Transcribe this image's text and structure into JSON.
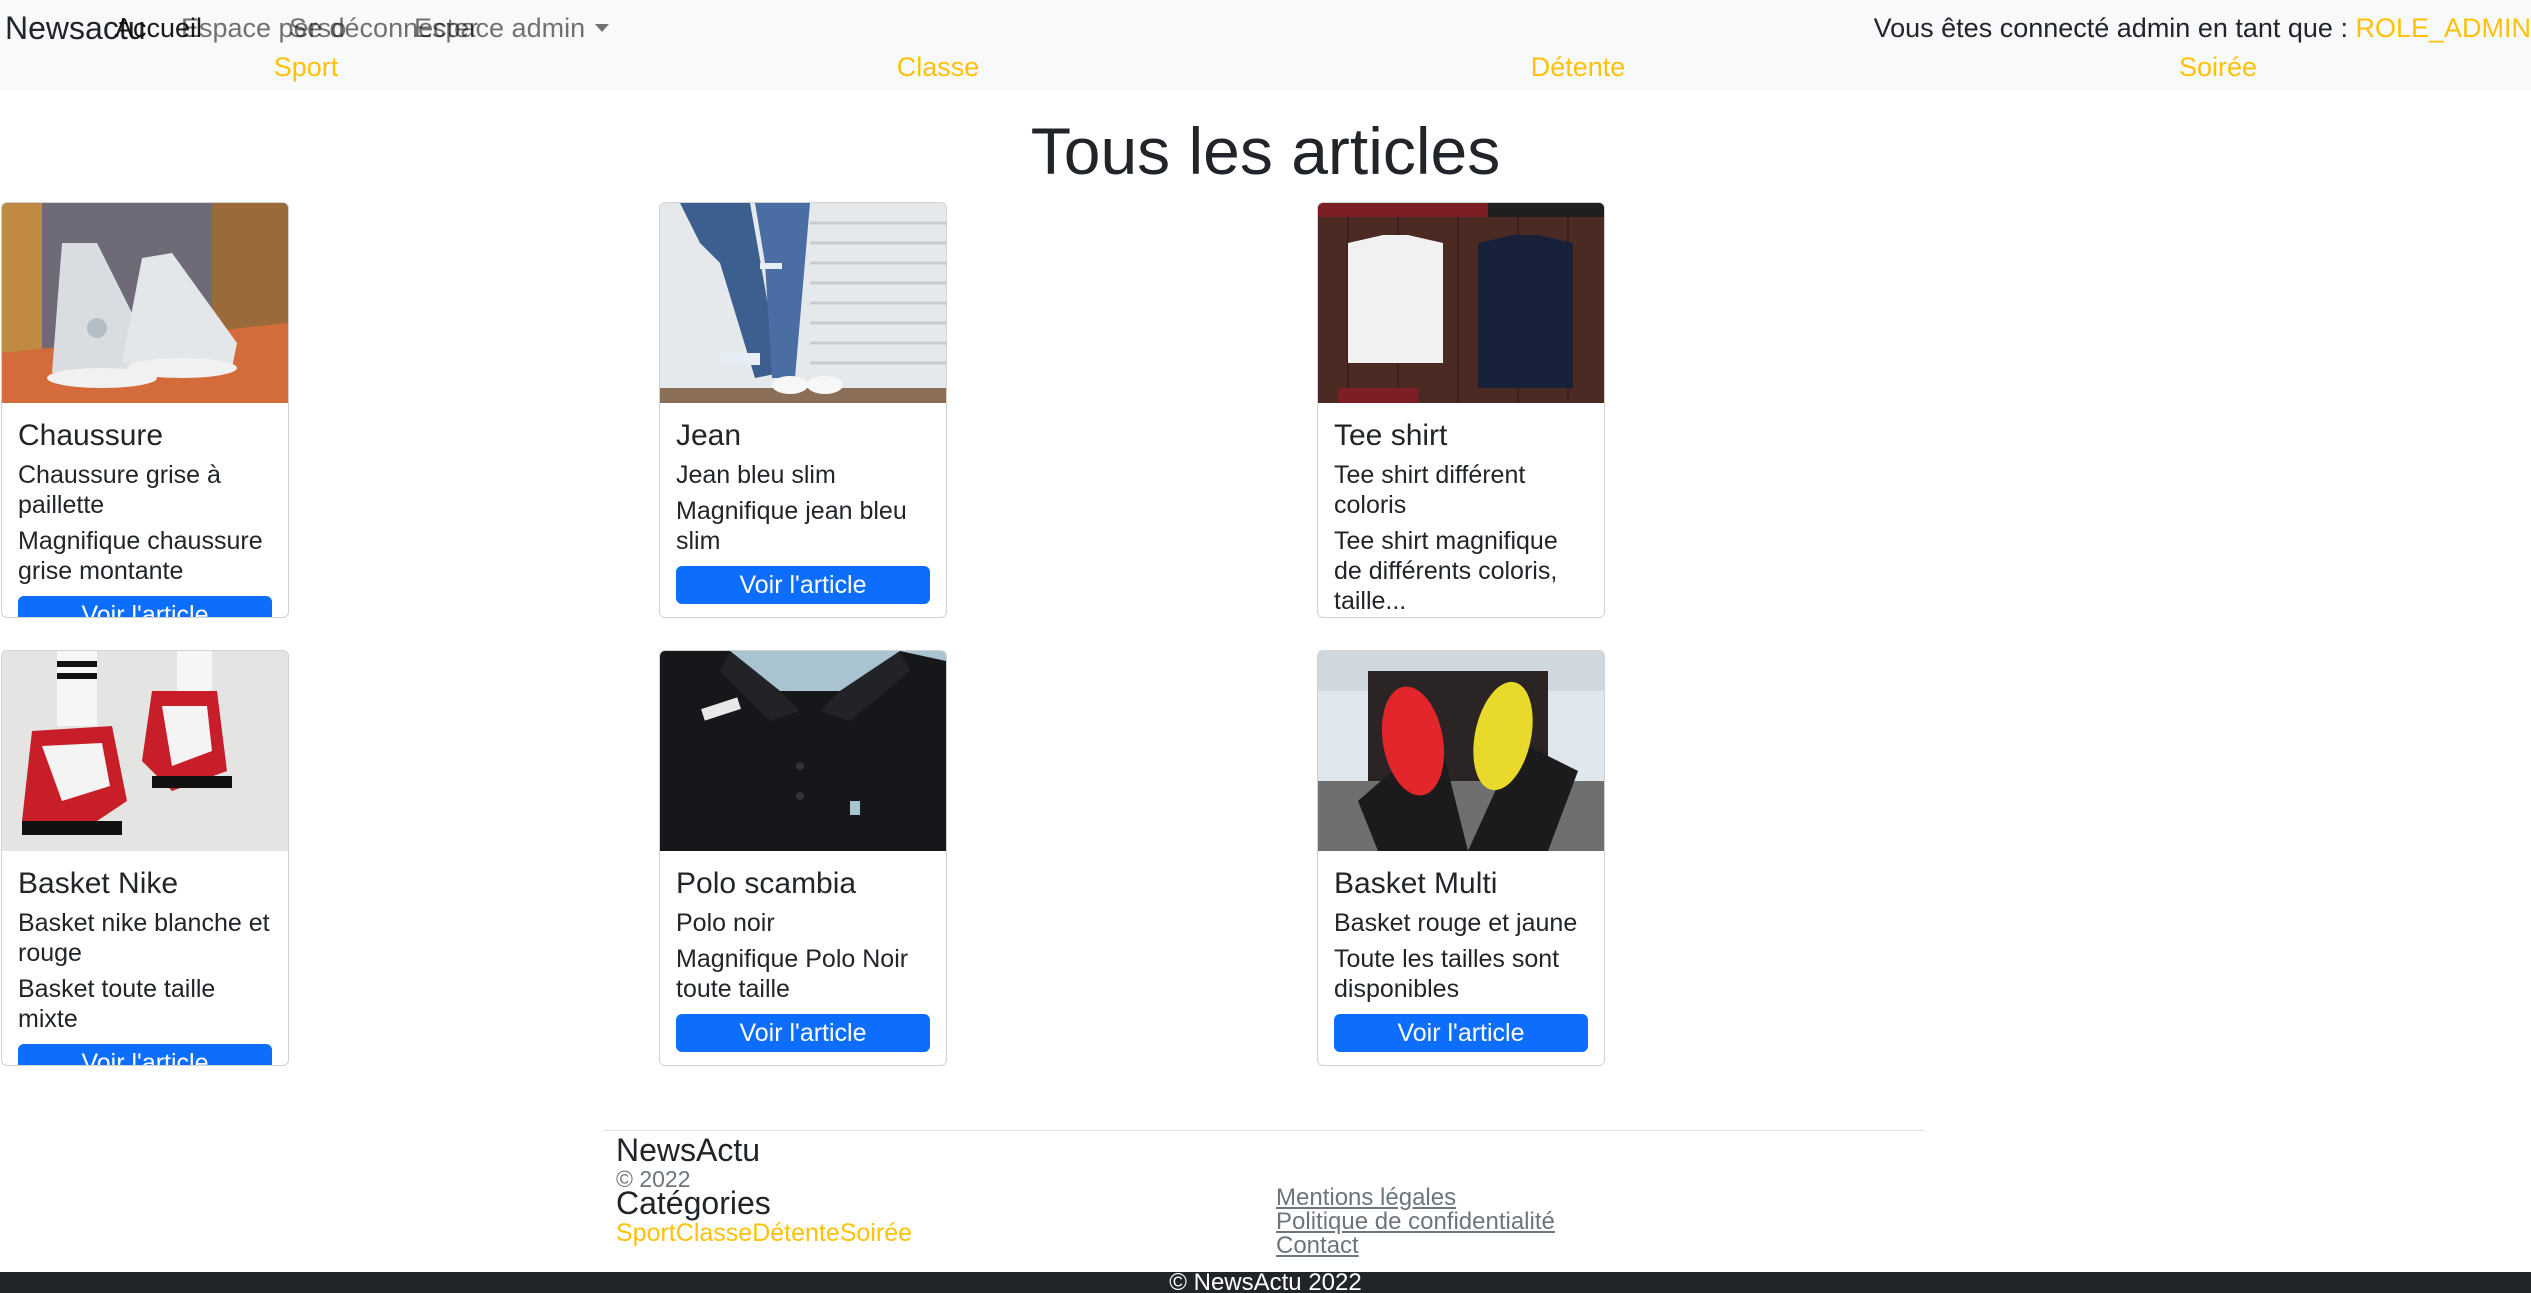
{
  "navbar": {
    "brand": "Newsactu",
    "links": [
      "Accueil",
      "Espace perso",
      "Se déconnecter",
      "Espace admin"
    ],
    "connected_text": "Vous êtes connecté admin en tant que : ",
    "role": "ROLE_ADMIN",
    "categories": [
      "Sport",
      "Classe",
      "Détente",
      "Soirée"
    ]
  },
  "main": {
    "title": "Tous les articles",
    "button_label": "Voir l'article",
    "articles": [
      {
        "title": "Chaussure",
        "subtitle": "Chaussure grise à paillette",
        "text": "Magnifique chaussure grise montante",
        "image": "grey-high-top-sneakers-photo"
      },
      {
        "title": "Jean",
        "subtitle": "Jean bleu slim",
        "text": "Magnifique jean bleu slim",
        "image": "blue-slim-jeans-photo"
      },
      {
        "title": "Tee shirt",
        "subtitle": "Tee shirt différent coloris",
        "text": "Tee shirt magnifique de différents coloris, taille...",
        "image": "folded-tee-shirts-photo"
      },
      {
        "title": "Basket Nike",
        "subtitle": "Basket nike blanche et rouge",
        "text": "Basket toute taille mixte",
        "image": "red-white-nike-sneakers-photo"
      },
      {
        "title": "Polo scambia",
        "subtitle": "Polo noir",
        "text": "Magnifique Polo Noir toute taille",
        "image": "black-polo-shirt-photo"
      },
      {
        "title": "Basket Multi",
        "subtitle": "Basket rouge et jaune",
        "text": "Toute les tailles sont disponibles",
        "image": "red-yellow-sneakers-photo"
      }
    ]
  },
  "footer": {
    "brand": "NewsActu",
    "copyright": "© 2022",
    "categories_title": "Catégories",
    "categories": [
      "Sport",
      "Classe",
      "Détente",
      "Soirée"
    ],
    "links": [
      "Mentions légales",
      "Politique de confidentialité",
      "Contact"
    ],
    "bottom": "© NewsActu 2022"
  },
  "colors": {
    "navbar_bg": "#f8f9fa",
    "accent_yellow": "#ffc107",
    "primary_button": "#0d6efd",
    "bottom_bar": "#212529"
  }
}
